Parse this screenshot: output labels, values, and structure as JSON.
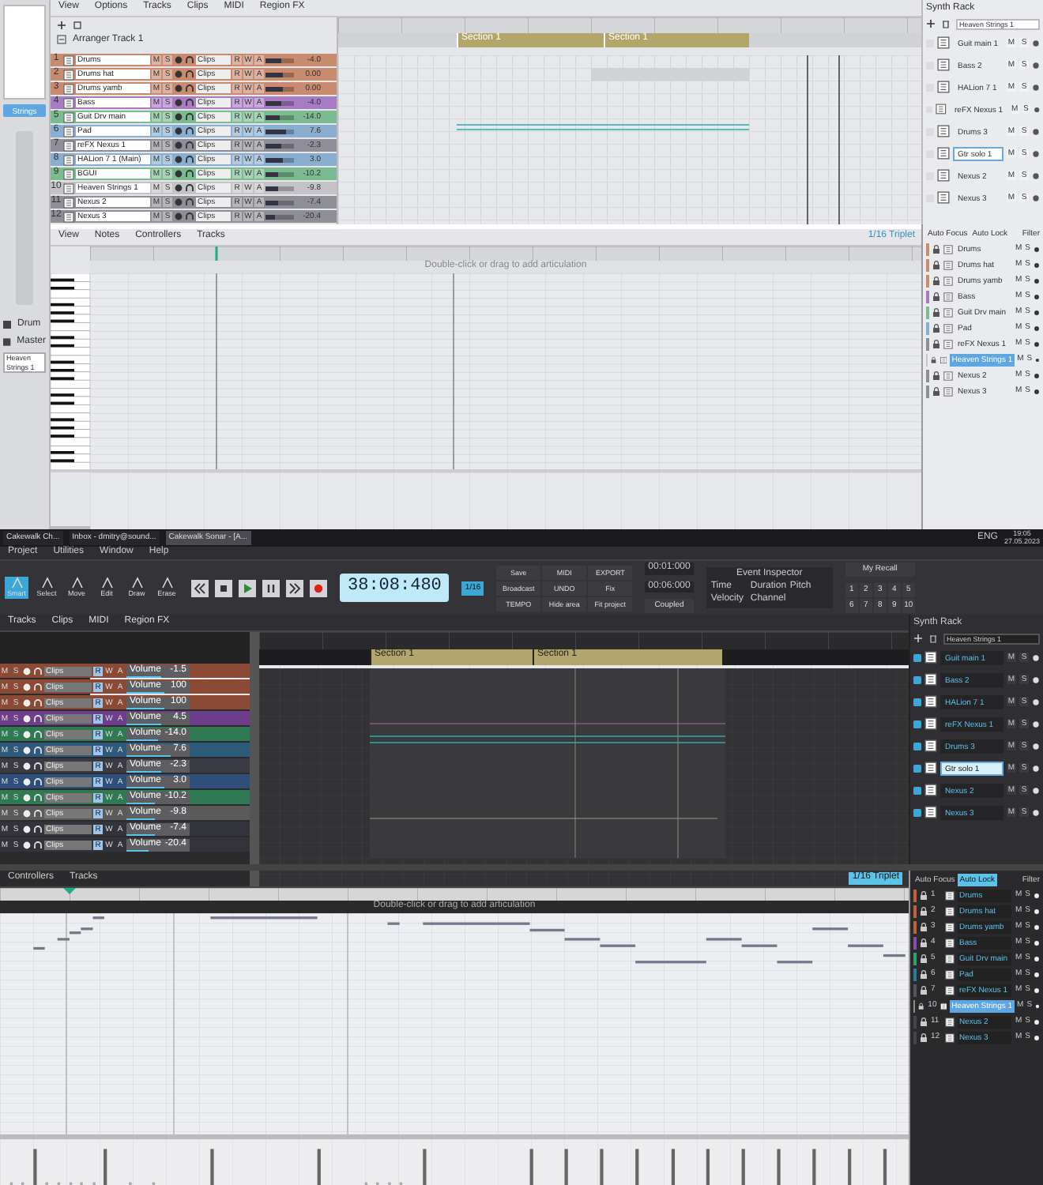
{
  "light": {
    "menu": [
      "View",
      "Options",
      "Tracks",
      "Clips",
      "MIDI",
      "Region FX"
    ],
    "inspector": {
      "mode": "Strings",
      "outputs": [
        "Drum",
        "Master"
      ],
      "track_name": "Heaven Strings 1"
    },
    "arranger": {
      "title": "Arranger Track 1",
      "sections": [
        "Section 1",
        "Section 1"
      ]
    },
    "tracks": [
      {
        "num": "1",
        "name": "Drums",
        "color": "#c98b70",
        "buttons": [
          "M",
          "S"
        ],
        "view": "Clips",
        "automation": [
          "R",
          "W",
          "A"
        ],
        "level": 0.55,
        "volume": "-4.0"
      },
      {
        "num": "2",
        "name": "Drums hat",
        "color": "#c98b70",
        "buttons": [
          "M",
          "S"
        ],
        "view": "Clips",
        "automation": [
          "R",
          "W",
          "A"
        ],
        "level": 0.6,
        "volume": "0.00"
      },
      {
        "num": "3",
        "name": "Drums yamb",
        "color": "#c98b70",
        "buttons": [
          "M",
          "S"
        ],
        "view": "Clips",
        "automation": [
          "R",
          "W",
          "A"
        ],
        "level": 0.6,
        "volume": "0.00"
      },
      {
        "num": "4",
        "name": "Bass",
        "color": "#a77cc2",
        "buttons": [
          "M",
          "S"
        ],
        "view": "Clips",
        "automation": [
          "R",
          "W",
          "A"
        ],
        "level": 0.55,
        "volume": "-4.0"
      },
      {
        "num": "5",
        "name": "Guit Drv main",
        "color": "#7cbb92",
        "buttons": [
          "M",
          "S"
        ],
        "view": "Clips",
        "automation": [
          "R",
          "W",
          "A"
        ],
        "level": 0.5,
        "volume": "-14.0"
      },
      {
        "num": "6",
        "name": "Pad",
        "color": "#8aaed0",
        "buttons": [
          "M",
          "S"
        ],
        "view": "Clips",
        "automation": [
          "R",
          "W",
          "A"
        ],
        "level": 0.7,
        "volume": "7.6"
      },
      {
        "num": "7",
        "name": "reFX Nexus 1",
        "color": "#8e8e96",
        "buttons": [
          "M",
          "S"
        ],
        "view": "Clips",
        "automation": [
          "R",
          "W",
          "A"
        ],
        "level": 0.55,
        "volume": "-2.3"
      },
      {
        "num": "8",
        "name": "HALion 7 1 (Main)",
        "color": "#8aaed0",
        "buttons": [
          "M",
          "S"
        ],
        "view": "Clips",
        "automation": [
          "R",
          "W",
          "A"
        ],
        "level": 0.6,
        "volume": "3.0"
      },
      {
        "num": "9",
        "name": "BGUI",
        "color": "#7cbb92",
        "buttons": [
          "M",
          "S"
        ],
        "view": "Clips",
        "automation": [
          "R",
          "W",
          "A"
        ],
        "level": 0.45,
        "volume": "-10.2"
      },
      {
        "num": "10",
        "name": "Heaven Strings 1",
        "color": "#c4c4c8",
        "buttons": [
          "M",
          "S"
        ],
        "view": "Clips",
        "automation": [
          "R",
          "W",
          "A"
        ],
        "level": 0.45,
        "volume": "-9.8"
      },
      {
        "num": "11",
        "name": "Nexus 2",
        "color": "#8e8e96",
        "buttons": [
          "M",
          "S"
        ],
        "view": "Clips",
        "automation": [
          "R",
          "W",
          "A"
        ],
        "level": 0.45,
        "volume": "-7.4"
      },
      {
        "num": "12",
        "name": "Nexus 3",
        "color": "#8e8e96",
        "buttons": [
          "M",
          "S"
        ],
        "view": "Clips",
        "automation": [
          "R",
          "W",
          "A"
        ],
        "level": 0.35,
        "volume": "-20.4"
      }
    ],
    "synth_rack": {
      "title": "Synth Rack",
      "preset": "Heaven Strings 1",
      "items": [
        {
          "name": "Guit main 1",
          "selected": false,
          "buttons": [
            "M",
            "S"
          ]
        },
        {
          "name": "Bass 2",
          "selected": false,
          "buttons": [
            "M",
            "S"
          ]
        },
        {
          "name": "HALion 7 1",
          "selected": false,
          "buttons": [
            "M",
            "S"
          ]
        },
        {
          "name": "reFX Nexus 1",
          "selected": false,
          "buttons": [
            "M",
            "S"
          ]
        },
        {
          "name": "Drums 3",
          "selected": false,
          "buttons": [
            "M",
            "S"
          ]
        },
        {
          "name": "Gtr solo 1",
          "selected": true,
          "buttons": [
            "M",
            "S"
          ]
        },
        {
          "name": "Nexus 2",
          "selected": false,
          "buttons": [
            "M",
            "S"
          ]
        },
        {
          "name": "Nexus 3",
          "selected": false,
          "buttons": [
            "M",
            "S"
          ]
        }
      ]
    },
    "piano_roll": {
      "menu": [
        "View",
        "Notes",
        "Controllers",
        "Tracks"
      ],
      "hint": "Double-click or drag to add articulation",
      "snap": "1/16 Triplet",
      "tabs": [
        {
          "label": "Auto Focus",
          "selected": false
        },
        {
          "label": "Auto Lock",
          "selected": false
        }
      ],
      "filter": "Filter",
      "tracks": [
        {
          "name": "Drums",
          "color": "#c98b70",
          "selected": false,
          "buttons": [
            "M",
            "S"
          ]
        },
        {
          "name": "Drums hat",
          "color": "#c98b70",
          "selected": false,
          "buttons": [
            "M",
            "S"
          ]
        },
        {
          "name": "Drums yamb",
          "color": "#c98b70",
          "selected": false,
          "buttons": [
            "M",
            "S"
          ]
        },
        {
          "name": "Bass",
          "color": "#a77cc2",
          "selected": false,
          "buttons": [
            "M",
            "S"
          ]
        },
        {
          "name": "Guit Drv main",
          "color": "#7cbb92",
          "selected": false,
          "buttons": [
            "M",
            "S"
          ]
        },
        {
          "name": "Pad",
          "color": "#8aaed0",
          "selected": false,
          "buttons": [
            "M",
            "S"
          ]
        },
        {
          "name": "reFX Nexus 1",
          "color": "#8e8e96",
          "selected": false,
          "buttons": [
            "M",
            "S"
          ]
        },
        {
          "name": "Heaven Strings 1",
          "color": "#c4c4c8",
          "selected": true,
          "buttons": [
            "M",
            "S"
          ]
        },
        {
          "name": "Nexus 2",
          "color": "#8e8e96",
          "selected": false,
          "buttons": [
            "M",
            "S"
          ]
        },
        {
          "name": "Nexus 3",
          "color": "#8e8e96",
          "selected": false,
          "buttons": [
            "M",
            "S"
          ]
        }
      ]
    }
  },
  "dark": {
    "taskbar": {
      "tabs": [
        {
          "label": "Cakewalk Ch...",
          "selected": false
        },
        {
          "label": "Inbox - dmitry@sound...",
          "selected": false
        },
        {
          "label": "Cakewalk Sonar - [A...",
          "selected": true
        }
      ],
      "language": "ENG",
      "time": "19:05",
      "date": "27.05.2023"
    },
    "menu": [
      "Project",
      "Utilities",
      "Window",
      "Help"
    ],
    "tools": [
      {
        "label": "Smart",
        "selected": true
      },
      {
        "label": "Select",
        "selected": false
      },
      {
        "label": "Move",
        "selected": false
      },
      {
        "label": "Edit",
        "selected": false
      },
      {
        "label": "Draw",
        "selected": false
      },
      {
        "label": "Erase",
        "selected": false
      }
    ],
    "time": "38:08:480",
    "snap": "1/16",
    "buttons": [
      "Save",
      "MIDI",
      "EXPORT",
      "Broadcast",
      "UNDO",
      "Fix",
      "TEMPO",
      "Hide area",
      "Fit project"
    ],
    "loop": [
      "00:01:000",
      "00:06:000"
    ],
    "coupled": "Coupled",
    "event_inspector": {
      "title": "Event Inspector",
      "fields": [
        "Time",
        "Duration",
        "Pitch",
        "Velocity",
        "Channel"
      ]
    },
    "recall": "My Recall",
    "keys": [
      "1",
      "2",
      "3",
      "4",
      "5",
      "6",
      "7",
      "8",
      "9",
      "10"
    ],
    "track_menu": [
      "Tracks",
      "Clips",
      "MIDI",
      "Region FX"
    ],
    "sections": [
      "Section 1",
      "Section 1"
    ],
    "tracks": [
      {
        "color": "#8a4a36",
        "buttons": [
          "M",
          "S"
        ],
        "view": "Clips",
        "automation": [
          "R",
          "W",
          "A"
        ],
        "label": "Volume",
        "level": 0.55,
        "volume": "-1.5"
      },
      {
        "color": "#8a4a36",
        "buttons": [
          "M",
          "S"
        ],
        "view": "Clips",
        "automation": [
          "R",
          "W",
          "A"
        ],
        "label": "Volume",
        "level": 0.6,
        "volume": "100"
      },
      {
        "color": "#8a4a36",
        "buttons": [
          "M",
          "S"
        ],
        "view": "Clips",
        "automation": [
          "R",
          "W",
          "A"
        ],
        "label": "Volume",
        "level": 0.6,
        "volume": "100"
      },
      {
        "color": "#6e3e8a",
        "buttons": [
          "M",
          "S"
        ],
        "view": "Clips",
        "automation": [
          "R",
          "W",
          "A"
        ],
        "label": "Volume",
        "level": 0.55,
        "volume": "4.5"
      },
      {
        "color": "#2f7a55",
        "buttons": [
          "M",
          "S"
        ],
        "view": "Clips",
        "automation": [
          "R",
          "W",
          "A"
        ],
        "label": "Volume",
        "level": 0.5,
        "volume": "-14.0"
      },
      {
        "color": "#2d5a7a",
        "buttons": [
          "M",
          "S"
        ],
        "view": "Clips",
        "automation": [
          "R",
          "W",
          "A"
        ],
        "label": "Volume",
        "level": 0.7,
        "volume": "7.6"
      },
      {
        "color": "#3a3a42",
        "buttons": [
          "M",
          "S"
        ],
        "view": "Clips",
        "automation": [
          "R",
          "W",
          "A"
        ],
        "label": "Volume",
        "level": 0.55,
        "volume": "-2.3"
      },
      {
        "color": "#2d4f7a",
        "buttons": [
          "M",
          "S"
        ],
        "view": "Clips",
        "automation": [
          "R",
          "W",
          "A"
        ],
        "label": "Volume",
        "level": 0.6,
        "volume": "3.0"
      },
      {
        "color": "#2f7a55",
        "buttons": [
          "M",
          "S"
        ],
        "view": "Clips",
        "automation": [
          "R",
          "W",
          "A"
        ],
        "label": "Volume",
        "level": 0.45,
        "volume": "-10.2"
      },
      {
        "color": "#5a5a5a",
        "buttons": [
          "M",
          "S"
        ],
        "view": "Clips",
        "automation": [
          "R",
          "W",
          "A"
        ],
        "label": "Volume",
        "level": 0.45,
        "volume": "-9.8"
      },
      {
        "color": "#33333b",
        "buttons": [
          "M",
          "S"
        ],
        "view": "Clips",
        "automation": [
          "R",
          "W",
          "A"
        ],
        "label": "Volume",
        "level": 0.45,
        "volume": "-7.4"
      },
      {
        "color": "#33333b",
        "buttons": [
          "M",
          "S"
        ],
        "view": "Clips",
        "automation": [
          "R",
          "W",
          "A"
        ],
        "label": "Volume",
        "level": 0.35,
        "volume": "-20.4"
      }
    ],
    "synth_rack": {
      "title": "Synth Rack",
      "preset": "Heaven Strings 1",
      "items": [
        {
          "name": "Guit main 1",
          "selected": false,
          "buttons": [
            "M",
            "S"
          ]
        },
        {
          "name": "Bass 2",
          "selected": false,
          "buttons": [
            "M",
            "S"
          ]
        },
        {
          "name": "HALion 7 1",
          "selected": false,
          "buttons": [
            "M",
            "S"
          ]
        },
        {
          "name": "reFX Nexus 1",
          "selected": false,
          "buttons": [
            "M",
            "S"
          ]
        },
        {
          "name": "Drums 3",
          "selected": false,
          "buttons": [
            "M",
            "S"
          ]
        },
        {
          "name": "Gtr solo 1",
          "selected": true,
          "buttons": [
            "M",
            "S"
          ]
        },
        {
          "name": "Nexus 2",
          "selected": false,
          "buttons": [
            "M",
            "S"
          ]
        },
        {
          "name": "Nexus 3",
          "selected": false,
          "buttons": [
            "M",
            "S"
          ]
        }
      ]
    },
    "piano_roll": {
      "menu": [
        "Controllers",
        "Tracks"
      ],
      "hint": "Double-click or drag to add articulation",
      "snap": "1/16 Triplet",
      "tabs": [
        {
          "label": "Auto Focus",
          "selected": false
        },
        {
          "label": "Auto Lock",
          "selected": true
        }
      ],
      "filter": "Filter",
      "tracks": [
        {
          "num": "1",
          "name": "Drums",
          "color": "#c0603c",
          "selected": false,
          "buttons": [
            "M",
            "S"
          ]
        },
        {
          "num": "2",
          "name": "Drums hat",
          "color": "#c0603c",
          "selected": false,
          "buttons": [
            "M",
            "S"
          ]
        },
        {
          "num": "3",
          "name": "Drums yamb",
          "color": "#c0603c",
          "selected": false,
          "buttons": [
            "M",
            "S"
          ]
        },
        {
          "num": "4",
          "name": "Bass",
          "color": "#8a4ab0",
          "selected": false,
          "buttons": [
            "M",
            "S"
          ]
        },
        {
          "num": "5",
          "name": "Guit Drv main",
          "color": "#2fa070",
          "selected": false,
          "buttons": [
            "M",
            "S"
          ]
        },
        {
          "num": "6",
          "name": "Pad",
          "color": "#2d7aa0",
          "selected": false,
          "buttons": [
            "M",
            "S"
          ]
        },
        {
          "num": "7",
          "name": "reFX Nexus 1",
          "color": "#55555f",
          "selected": false,
          "buttons": [
            "M",
            "S"
          ]
        },
        {
          "num": "10",
          "name": "Heaven Strings 1",
          "color": "#8a8a8a",
          "selected": true,
          "buttons": [
            "M",
            "S"
          ]
        },
        {
          "num": "11",
          "name": "Nexus 2",
          "color": "#44444c",
          "selected": false,
          "buttons": [
            "M",
            "S"
          ]
        },
        {
          "num": "12",
          "name": "Nexus 3",
          "color": "#44444c",
          "selected": false,
          "buttons": [
            "M",
            "S"
          ]
        }
      ]
    }
  }
}
